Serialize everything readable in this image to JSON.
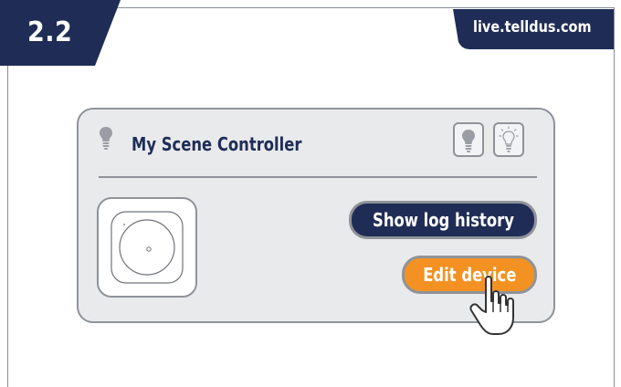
{
  "step": {
    "number": "2.2"
  },
  "site": {
    "url": "live.telldus.com"
  },
  "card": {
    "title": "My Scene Controller",
    "title_icon": "lightbulb-icon",
    "toggle_off_icon": "lightbulb-off-icon",
    "toggle_on_icon": "lightbulb-on-icon",
    "device_icon": "scene-controller-device-icon",
    "buttons": {
      "log_history": "Show log history",
      "edit_device": "Edit device"
    }
  },
  "cursor_icon": "hand-pointer-icon",
  "colors": {
    "navy": "#1f2d56",
    "orange": "#f39222",
    "card_bg": "#e9eaec",
    "border": "#8f9399"
  }
}
